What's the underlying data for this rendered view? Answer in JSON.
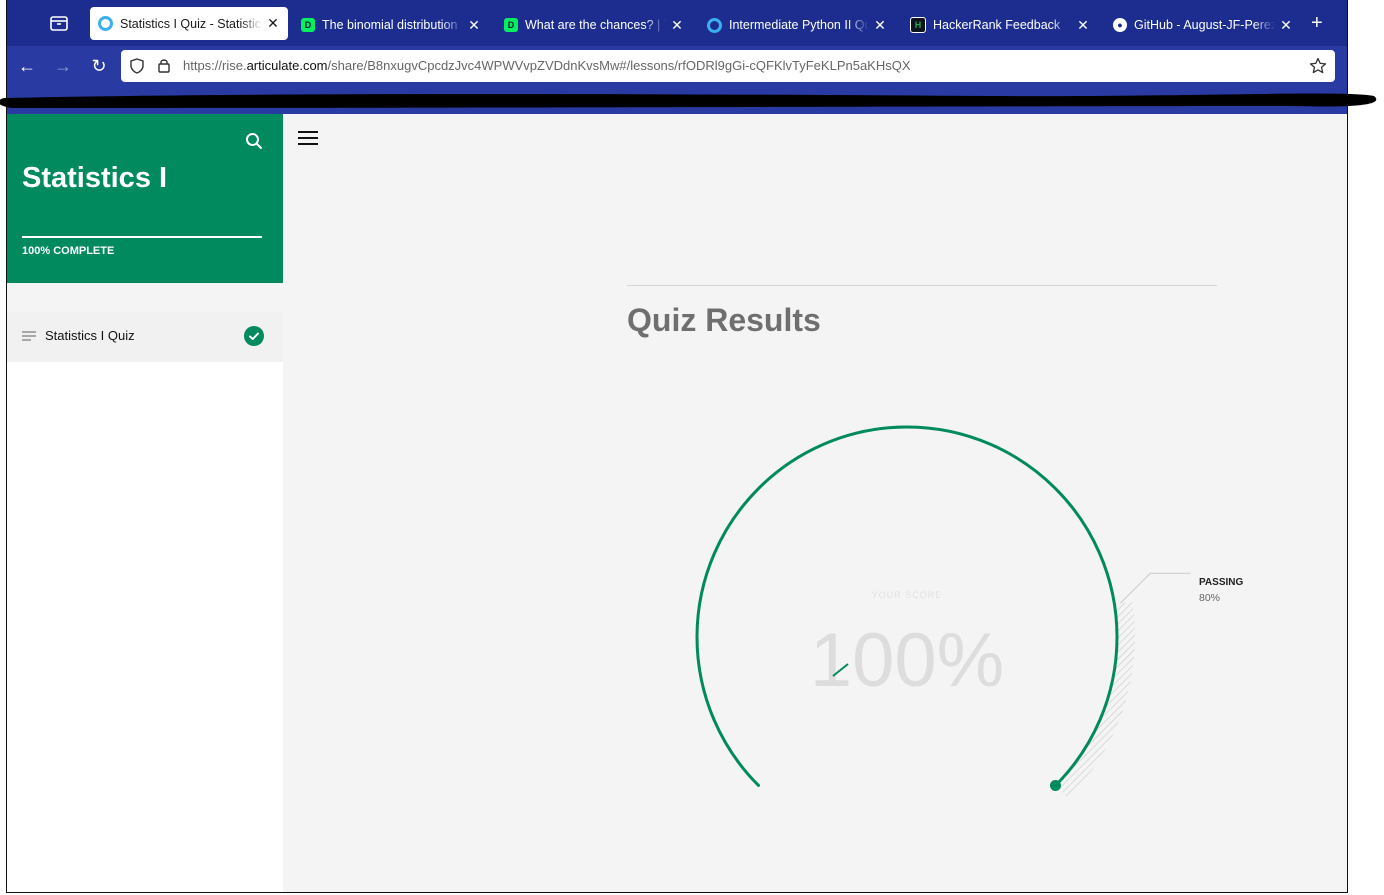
{
  "browser": {
    "tabs": [
      {
        "title": "Statistics I Quiz - Statistics I",
        "icon": "articulate-icon",
        "active": true
      },
      {
        "title": "The binomial distribution | Th",
        "icon": "datacamp-icon"
      },
      {
        "title": "What are the chances? | The",
        "icon": "datacamp-icon"
      },
      {
        "title": "Intermediate Python II Quiz",
        "icon": "articulate-icon"
      },
      {
        "title": "HackerRank Feedback",
        "icon": "hackerrank-icon"
      },
      {
        "title": "GitHub - August-JF-Perez/",
        "icon": "github-icon"
      }
    ],
    "url_prefix": "https://rise.",
    "url_domain": "articulate.com",
    "url_suffix": "/share/B8nxugvCpcdzJvc4WPWVvpZVDdnKvsMw#/lessons/rfODRl9gGi-cQFKlvTyFeKLPn5aKHsQX"
  },
  "sidebar": {
    "course_title": "Statistics I",
    "progress_text": "100% COMPLETE",
    "progress_fraction": 1.0,
    "lessons": [
      {
        "label": "Statistics I Quiz",
        "completed": true
      }
    ]
  },
  "main": {
    "heading": "Quiz Results",
    "score_label": "YOUR SCORE",
    "score_value": "100%",
    "score_fraction": 1.0,
    "passing_label": "PASSING",
    "passing_value": "80%",
    "passing_fraction": 0.8
  },
  "colors": {
    "accent": "#008a5e",
    "tabbar": "#1c2d8f",
    "navbar": "#2a3aa3"
  }
}
